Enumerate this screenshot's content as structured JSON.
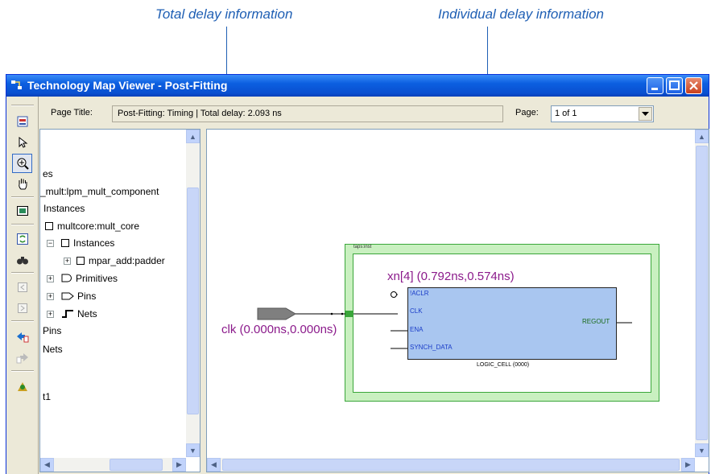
{
  "callouts": {
    "total": "Total delay information",
    "individual": "Individual delay information"
  },
  "window": {
    "title": "Technology Map Viewer - Post-Fitting",
    "page_title_label": "Page Title:",
    "page_title_value": "Post-Fitting: Timing | Total delay: 2.093 ns",
    "page_label": "Page:",
    "page_value": "1 of 1"
  },
  "tree": {
    "items": [
      "es",
      "_mult:lpm_mult_component",
      "Instances",
      "multcore:mult_core",
      "Instances",
      "mpar_add:padder",
      "Primitives",
      "Pins",
      "Nets",
      "Pins",
      "Nets",
      "t1"
    ]
  },
  "schematic": {
    "region_label": "taps:inst",
    "cell_label": "xn[4] (0.792ns,0.574ns)",
    "clk_label": "clk (0.000ns,0.000ns)",
    "ports": [
      "!ACLR",
      "CLK",
      "ENA",
      "SYNCH_DATA"
    ],
    "out_port": "REGOUT",
    "cell_name": "LOGIC_CELL (0000)"
  },
  "colors": {
    "callout": "#1f5fb4",
    "delay_text": "#8b1a8b",
    "cell_fill": "#a9c6f0",
    "region_fill": "#c9f0c0",
    "region_border": "#3aa63a"
  },
  "icons": {
    "toolbar": [
      "page-setup-icon",
      "pointer-icon",
      "zoom-icon",
      "hand-icon",
      "fit-window-icon",
      "refresh-icon",
      "find-icon",
      "back-icon",
      "forward-icon",
      "go-back-icon",
      "go-forward-icon",
      "netlist-icon"
    ]
  }
}
